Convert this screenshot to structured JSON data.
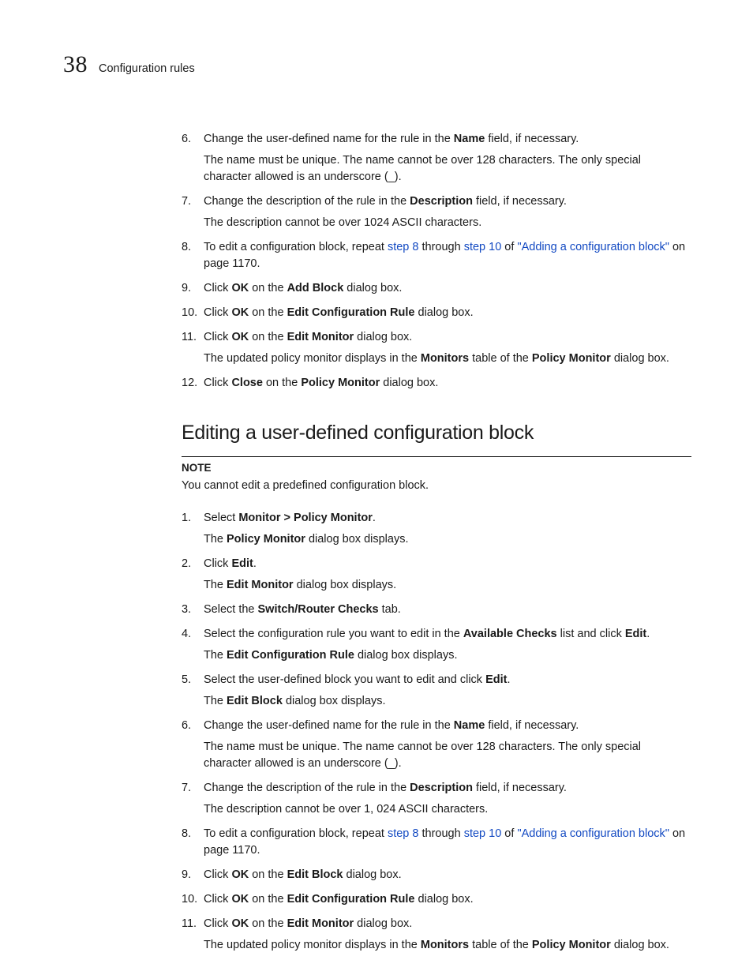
{
  "header": {
    "chapter_number": "38",
    "chapter_title": "Configuration rules"
  },
  "section1_steps": [
    {
      "n": "6.",
      "line": [
        {
          "t": "Change the user-defined name for the rule in the "
        },
        {
          "t": "Name",
          "b": true
        },
        {
          "t": " field, if necessary."
        }
      ],
      "sub": "The name must be unique. The name cannot be over 128 characters. The only special character allowed is an underscore (_)."
    },
    {
      "n": "7.",
      "line": [
        {
          "t": "Change the description of the rule in the "
        },
        {
          "t": "Description",
          "b": true
        },
        {
          "t": " field, if necessary."
        }
      ],
      "sub": "The description cannot be over 1024 ASCII characters."
    },
    {
      "n": "8.",
      "line": [
        {
          "t": "To edit a configuration block, repeat "
        },
        {
          "t": "step 8",
          "link": true
        },
        {
          "t": " through "
        },
        {
          "t": "step 10",
          "link": true
        },
        {
          "t": " of "
        },
        {
          "t": "\"Adding a configuration block\"",
          "link": true
        },
        {
          "t": " on page 1170."
        }
      ]
    },
    {
      "n": "9.",
      "line": [
        {
          "t": "Click "
        },
        {
          "t": "OK",
          "b": true
        },
        {
          "t": " on the "
        },
        {
          "t": "Add Block",
          "b": true
        },
        {
          "t": " dialog box."
        }
      ]
    },
    {
      "n": "10.",
      "line": [
        {
          "t": "Click "
        },
        {
          "t": "OK",
          "b": true
        },
        {
          "t": " on the "
        },
        {
          "t": "Edit Configuration Rule",
          "b": true
        },
        {
          "t": " dialog box."
        }
      ]
    },
    {
      "n": "11.",
      "line": [
        {
          "t": "Click "
        },
        {
          "t": "OK",
          "b": true
        },
        {
          "t": " on the "
        },
        {
          "t": "Edit Monitor",
          "b": true
        },
        {
          "t": " dialog box."
        }
      ],
      "sub_rich": [
        {
          "t": "The updated policy monitor displays in the "
        },
        {
          "t": "Monitors",
          "b": true
        },
        {
          "t": " table of the "
        },
        {
          "t": "Policy Monitor",
          "b": true
        },
        {
          "t": " dialog box."
        }
      ]
    },
    {
      "n": "12.",
      "line": [
        {
          "t": "Click "
        },
        {
          "t": "Close",
          "b": true
        },
        {
          "t": " on the "
        },
        {
          "t": "Policy Monitor",
          "b": true
        },
        {
          "t": " dialog box."
        }
      ]
    }
  ],
  "section2_heading": "Editing a user-defined configuration block",
  "note": {
    "label": "NOTE",
    "body": "You cannot edit a predefined configuration block."
  },
  "section2_steps": [
    {
      "n": "1.",
      "line": [
        {
          "t": "Select "
        },
        {
          "t": "Monitor > Policy Monitor",
          "b": true
        },
        {
          "t": "."
        }
      ],
      "sub_rich": [
        {
          "t": "The "
        },
        {
          "t": "Policy Monitor",
          "b": true
        },
        {
          "t": " dialog box displays."
        }
      ]
    },
    {
      "n": "2.",
      "line": [
        {
          "t": "Click "
        },
        {
          "t": "Edit",
          "b": true
        },
        {
          "t": "."
        }
      ],
      "sub_rich": [
        {
          "t": "The "
        },
        {
          "t": "Edit Monitor",
          "b": true
        },
        {
          "t": " dialog box displays."
        }
      ]
    },
    {
      "n": "3.",
      "line": [
        {
          "t": "Select the "
        },
        {
          "t": "Switch/Router Checks",
          "b": true
        },
        {
          "t": " tab."
        }
      ]
    },
    {
      "n": "4.",
      "line": [
        {
          "t": "Select the configuration rule you want to edit in the "
        },
        {
          "t": "Available Checks",
          "b": true
        },
        {
          "t": " list and click "
        },
        {
          "t": "Edit",
          "b": true
        },
        {
          "t": "."
        }
      ],
      "sub_rich": [
        {
          "t": "The "
        },
        {
          "t": "Edit Configuration Rule",
          "b": true
        },
        {
          "t": " dialog box displays."
        }
      ]
    },
    {
      "n": "5.",
      "line": [
        {
          "t": "Select the user-defined block you want to edit and click "
        },
        {
          "t": "Edit",
          "b": true
        },
        {
          "t": "."
        }
      ],
      "sub_rich": [
        {
          "t": "The "
        },
        {
          "t": "Edit Block",
          "b": true
        },
        {
          "t": " dialog box displays."
        }
      ]
    },
    {
      "n": "6.",
      "line": [
        {
          "t": "Change the user-defined name for the rule in the "
        },
        {
          "t": "Name",
          "b": true
        },
        {
          "t": " field, if necessary."
        }
      ],
      "sub": "The name must be unique. The name cannot be over 128 characters. The only special character allowed is an underscore (_)."
    },
    {
      "n": "7.",
      "line": [
        {
          "t": "Change the description of the rule in the "
        },
        {
          "t": "Description",
          "b": true
        },
        {
          "t": " field, if necessary."
        }
      ],
      "sub": "The description cannot be over 1, 024 ASCII characters."
    },
    {
      "n": "8.",
      "line": [
        {
          "t": "To edit a configuration block, repeat "
        },
        {
          "t": "step 8",
          "link": true
        },
        {
          "t": " through "
        },
        {
          "t": "step 10",
          "link": true
        },
        {
          "t": " of "
        },
        {
          "t": "\"Adding a configuration block\"",
          "link": true
        },
        {
          "t": " on page 1170."
        }
      ]
    },
    {
      "n": "9.",
      "line": [
        {
          "t": "Click "
        },
        {
          "t": "OK",
          "b": true
        },
        {
          "t": " on the "
        },
        {
          "t": "Edit Block",
          "b": true
        },
        {
          "t": " dialog box."
        }
      ]
    },
    {
      "n": "10.",
      "line": [
        {
          "t": "Click "
        },
        {
          "t": "OK",
          "b": true
        },
        {
          "t": " on the "
        },
        {
          "t": "Edit Configuration Rule",
          "b": true
        },
        {
          "t": " dialog box."
        }
      ]
    },
    {
      "n": "11.",
      "line": [
        {
          "t": "Click "
        },
        {
          "t": "OK",
          "b": true
        },
        {
          "t": " on the "
        },
        {
          "t": "Edit Monitor",
          "b": true
        },
        {
          "t": " dialog box."
        }
      ],
      "sub_rich": [
        {
          "t": "The updated policy monitor displays in the "
        },
        {
          "t": "Monitors",
          "b": true
        },
        {
          "t": " table of the "
        },
        {
          "t": "Policy Monitor",
          "b": true
        },
        {
          "t": " dialog box."
        }
      ]
    }
  ]
}
